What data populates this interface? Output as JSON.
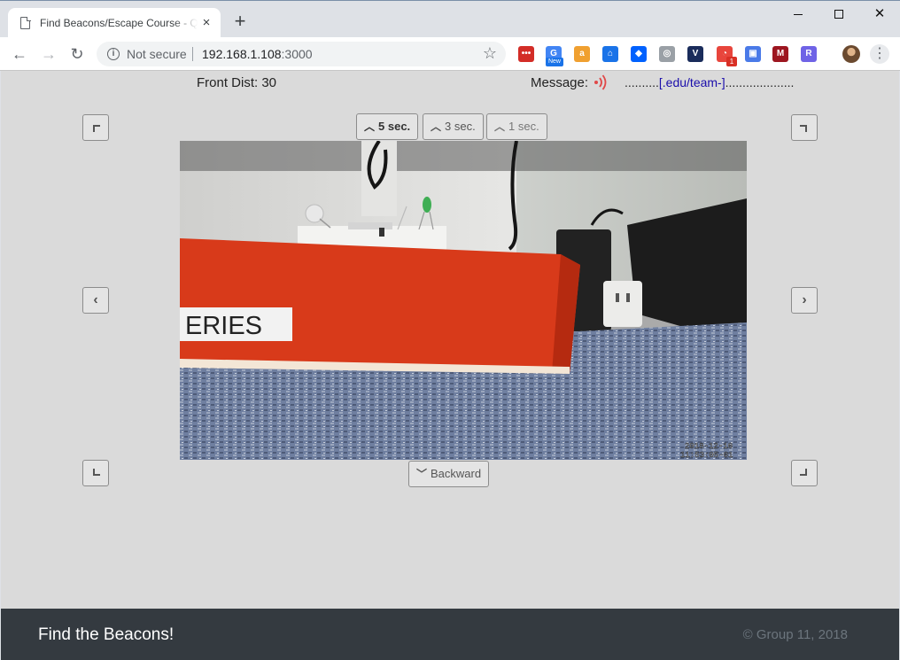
{
  "browser": {
    "tab_title": "Find Beacons/Escape Course - Qu",
    "tab_close": "×",
    "new_tab": "+",
    "security_label": "Not secure",
    "url_host": "192.168.1.108",
    "url_port": ":3000",
    "new_badge": "New",
    "ext_badge": "1",
    "extensions": [
      {
        "name": "lastpass-icon",
        "color": "#d32d27",
        "glyph": "•••"
      },
      {
        "name": "google-news-icon",
        "color": "#4285f4",
        "glyph": "G"
      },
      {
        "name": "amazon-icon",
        "color": "#f0a030",
        "glyph": "a"
      },
      {
        "name": "institution-icon",
        "color": "#1a73e8",
        "glyph": "⌂"
      },
      {
        "name": "dropbox-icon",
        "color": "#0061fe",
        "glyph": "◆"
      },
      {
        "name": "fingerprint-icon",
        "color": "#9aa0a6",
        "glyph": "◎"
      },
      {
        "name": "vimeo-icon",
        "color": "#1a2c5b",
        "glyph": "V"
      },
      {
        "name": "pocket-icon",
        "color": "#e8453c",
        "glyph": "◔"
      },
      {
        "name": "bookmark-manager-icon",
        "color": "#4a7ae8",
        "glyph": "▣"
      },
      {
        "name": "mendeley-icon",
        "color": "#9d1620",
        "glyph": "M"
      },
      {
        "name": "r-extension-icon",
        "color": "#6f63e6",
        "glyph": "R"
      }
    ]
  },
  "status": {
    "front_dist": "Front Dist: 30",
    "message_label": "Message:",
    "message_prefix": "..........",
    "message_link": "[.edu/team-]",
    "message_suffix": "...................."
  },
  "controls": {
    "forward_5": "5 sec.",
    "forward_3": "3 sec.",
    "forward_1": "1 sec.",
    "backward": "Backward",
    "left_glyph": "‹",
    "right_glyph": "›"
  },
  "camera": {
    "box_label": "ERIES",
    "timestamp_date": "2018-12-10",
    "timestamp_time": "11:53:05-01"
  },
  "footer": {
    "title": "Find the Beacons!",
    "copyright": "© Group 11, 2018"
  },
  "colors": {
    "page_bg": "#dadada",
    "footer_bg": "#343a40",
    "link": "#1a0dab",
    "signal": "#e04848",
    "box_red": "#d83a1a"
  }
}
